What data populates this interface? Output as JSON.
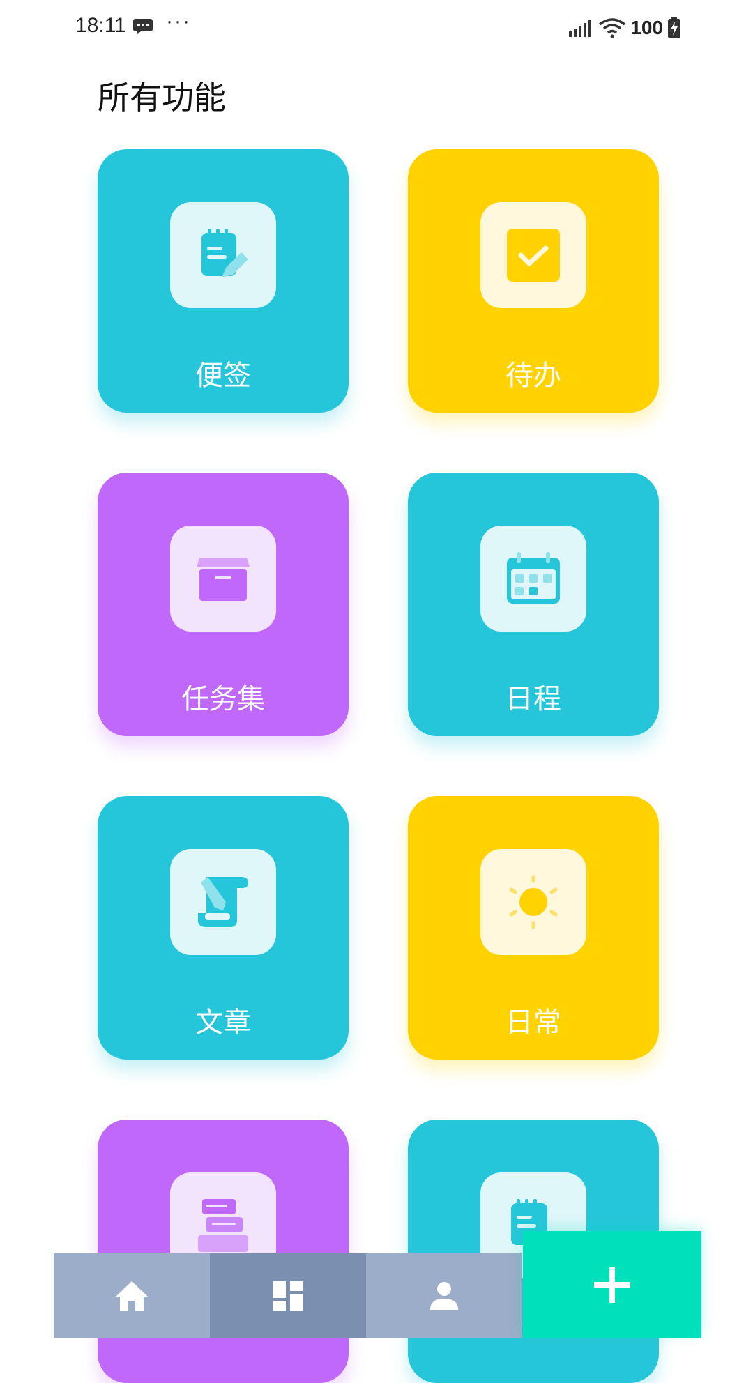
{
  "status_bar": {
    "time": "18:11",
    "more": "···",
    "battery": "100"
  },
  "page": {
    "title": "所有功能"
  },
  "features": [
    {
      "label": "便签",
      "icon": "note-edit-icon",
      "color": "#26C6DA"
    },
    {
      "label": "待办",
      "icon": "checkbox-icon",
      "color": "#FFD200"
    },
    {
      "label": "任务集",
      "icon": "archive-box-icon",
      "color": "#BF68F9"
    },
    {
      "label": "日程",
      "icon": "calendar-icon",
      "color": "#26C6DA"
    },
    {
      "label": "文章",
      "icon": "scroll-edit-icon",
      "color": "#26C6DA"
    },
    {
      "label": "日常",
      "icon": "sun-icon",
      "color": "#FFD200"
    },
    {
      "label": "",
      "icon": "stack-icon",
      "color": "#BF68F9"
    },
    {
      "label": "",
      "icon": "note-chart-icon",
      "color": "#26C6DA"
    }
  ],
  "bottom_nav": {
    "items": [
      {
        "icon": "home-icon"
      },
      {
        "icon": "dashboard-icon",
        "active": true
      },
      {
        "icon": "person-icon"
      }
    ],
    "fab_icon": "plus-icon",
    "fab_color": "#00E0BB"
  }
}
